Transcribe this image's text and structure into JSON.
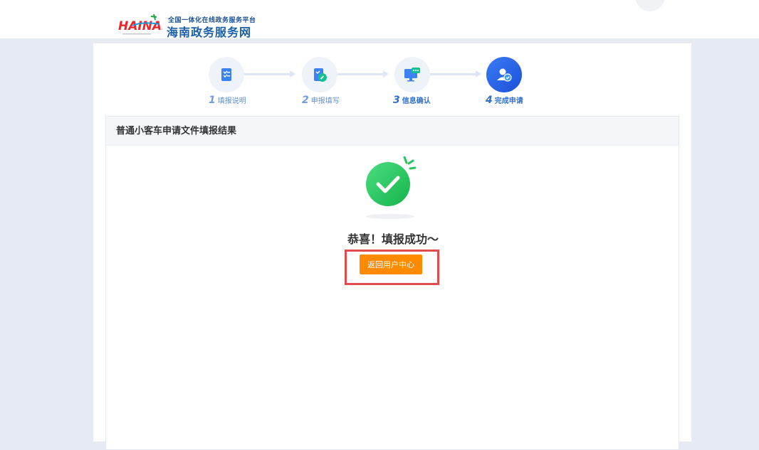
{
  "header": {
    "subtitle": "全国一体化在线政务服务平台",
    "title": "海南政务服务网",
    "logo_text": "HAINAN"
  },
  "steps": [
    {
      "num": "1",
      "label": "填报说明"
    },
    {
      "num": "2",
      "label": "申报填写"
    },
    {
      "num": "3",
      "label": "信息确认"
    },
    {
      "num": "4",
      "label": "完成申请"
    }
  ],
  "panel": {
    "title": "普通小客车申请文件填报结果"
  },
  "result": {
    "message": "恭喜！填报成功～",
    "button_label": "返回用户中心"
  },
  "colors": {
    "accent": "#ff8a00",
    "success": "#22c55e",
    "step_active": "#2a62e8",
    "highlight": "#e14b4b"
  }
}
